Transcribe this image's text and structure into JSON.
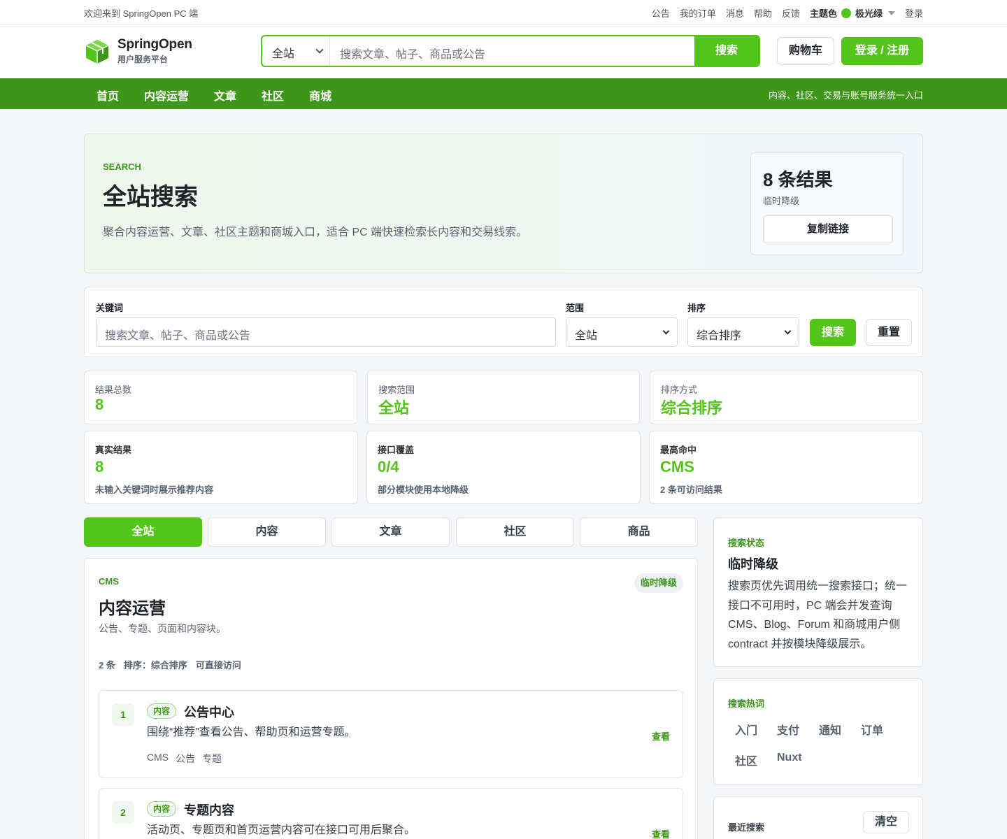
{
  "topbar": {
    "welcome": "欢迎来到 SpringOpen PC 端",
    "links": [
      "公告",
      "我的订单",
      "消息",
      "帮助",
      "反馈"
    ],
    "theme_label": "主题色",
    "theme_value": "极光绿",
    "theme_color": "#52c41a",
    "login": "登录"
  },
  "header": {
    "brand_name": "SpringOpen",
    "brand_sub": "用户服务平台",
    "search_scope": "全站",
    "search_placeholder": "搜索文章、帖子、商品或公告",
    "search_button": "搜索",
    "cart_button": "购物车",
    "login_register_button": "登录 / 注册"
  },
  "nav": {
    "items": [
      "首页",
      "内容运营",
      "文章",
      "社区",
      "商城"
    ],
    "tagline": "内容、社区、交易与账号服务统一入口"
  },
  "hero": {
    "eyebrow": "SEARCH",
    "title": "全站搜索",
    "description": "聚合内容运营、文章、社区主题和商城入口，适合 PC 端快速检索长内容和交易线索。",
    "result_count": "8 条结果",
    "mode": "临时降级",
    "copy_link": "复制链接"
  },
  "filter": {
    "keyword_label": "关键词",
    "keyword_placeholder": "搜索文章、帖子、商品或公告",
    "scope_label": "范围",
    "scope_value": "全站",
    "sort_label": "排序",
    "sort_value": "综合排序",
    "search_button": "搜索",
    "reset_button": "重置"
  },
  "stats": {
    "row1": [
      {
        "label": "结果总数",
        "value": "8"
      },
      {
        "label": "搜索范围",
        "value": "全站"
      },
      {
        "label": "排序方式",
        "value": "综合排序"
      }
    ],
    "row2": [
      {
        "label": "真实结果",
        "value": "8",
        "note": "未输入关键词时展示推荐内容"
      },
      {
        "label": "接口覆盖",
        "value": "0/4",
        "note": "部分模块使用本地降级"
      },
      {
        "label": "最高命中",
        "value": "CMS",
        "note": "2 条可访问结果"
      }
    ]
  },
  "tabs": [
    "全站",
    "内容",
    "文章",
    "社区",
    "商品"
  ],
  "section": {
    "code": "CMS",
    "title": "内容运营",
    "description": "公告、专题、页面和内容块。",
    "badge": "临时降级",
    "meta": [
      "2 条",
      "排序：综合排序",
      "可直接访问"
    ],
    "items": [
      {
        "num": "1",
        "kind": "内容",
        "title": "公告中心",
        "desc": "围绕“推荐”查看公告、帮助页和运营专题。",
        "tags": [
          "CMS",
          "公告",
          "专题"
        ],
        "action": "查看"
      },
      {
        "num": "2",
        "kind": "内容",
        "title": "专题内容",
        "desc": "活动页、专题页和首页运营内容可在接口可用后聚合。",
        "tags": [],
        "action": "查看"
      }
    ]
  },
  "sidebar": {
    "status": {
      "heading": "搜索状态",
      "title": "临时降级",
      "text": "搜索页优先调用统一搜索接口；统一接口不可用时，PC 端会并发查询 CMS、Blog、Forum 和商城用户侧 contract 并按模块降级展示。"
    },
    "hot": {
      "heading": "搜索热词",
      "words": [
        "入门",
        "支付",
        "通知",
        "订单",
        "社区",
        "Nuxt"
      ]
    },
    "recent": {
      "heading": "最近搜索",
      "clear": "清空"
    }
  }
}
